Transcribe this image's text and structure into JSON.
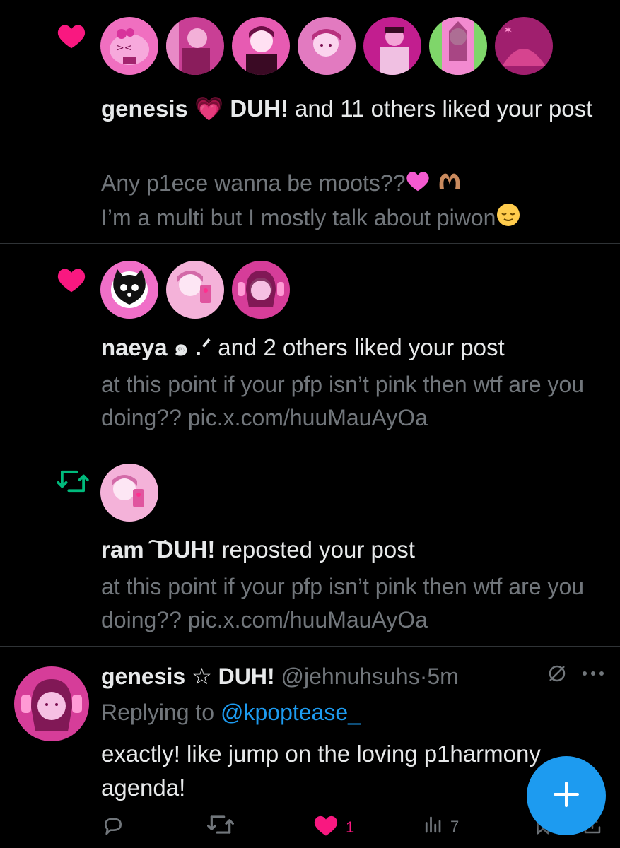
{
  "colors": {
    "like_pink": "#f91880",
    "repost_green": "#00ba7c",
    "link_blue": "#1d9bf0",
    "muted": "#71767b",
    "text": "#e7e9ea"
  },
  "notifications": [
    {
      "type": "like",
      "icon": "heart-icon",
      "avatar_count": 7,
      "title_name": "genesis 💗 DUH!",
      "title_rest": " and 11 others liked your post",
      "body_line1": "Any p1ece wanna be moots??",
      "body_line2": "I’m a multi but I mostly talk about piwon"
    },
    {
      "type": "like",
      "icon": "heart-icon",
      "avatar_count": 3,
      "title_name": "naeya ๑ .ᐟ",
      "title_rest": " and 2 others liked your post",
      "body": "at this point if your pfp isn’t pink then wtf are you doing?? pic.x.com/huuMauAyOa"
    },
    {
      "type": "repost",
      "icon": "repost-icon",
      "avatar_count": 1,
      "title_name": "ram ͠ DUH!",
      "title_rest": " reposted your post",
      "body": "at this point if your pfp isn’t pink then wtf are you doing?? pic.x.com/huuMauAyOa"
    }
  ],
  "reply": {
    "display_name": "genesis ☆ DUH!",
    "handle": "@jehnuhsuhs",
    "separator": "·",
    "time": "5m",
    "replying_prefix": "Replying to ",
    "replying_to": "@kpoptease_",
    "text": "exactly! like jump on the loving p1harmony agenda!",
    "actions": {
      "reply_count": "",
      "repost_count": "",
      "like_count": "1",
      "views_count": "7"
    }
  },
  "fab": {
    "icon": "plus-icon"
  }
}
